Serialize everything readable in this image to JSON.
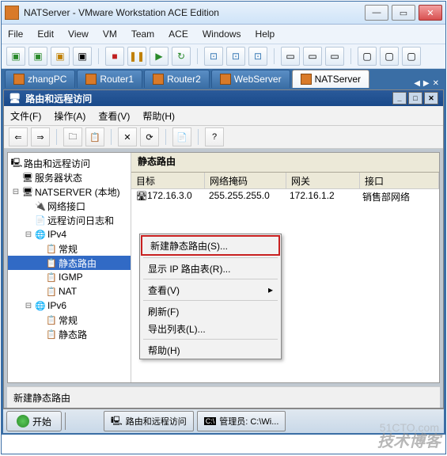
{
  "window": {
    "title": "NATServer - VMware Workstation ACE Edition"
  },
  "menubar": [
    "File",
    "Edit",
    "View",
    "VM",
    "Team",
    "ACE",
    "Windows",
    "Help"
  ],
  "tabs": [
    {
      "label": "zhangPC"
    },
    {
      "label": "Router1"
    },
    {
      "label": "Router2"
    },
    {
      "label": "WebServer"
    },
    {
      "label": "NATServer",
      "active": true
    }
  ],
  "inner": {
    "title": "路由和远程访问",
    "menu": [
      "文件(F)",
      "操作(A)",
      "查看(V)",
      "帮助(H)"
    ]
  },
  "tree": {
    "root": "路由和远程访问",
    "status": "服务器状态",
    "server": "NATSERVER (本地)",
    "items": {
      "netif": "网络接口",
      "remotelog": "远程访问日志和",
      "ipv4": "IPv4",
      "ipv4_general": "常规",
      "ipv4_static": "静态路由",
      "ipv4_igmp": "IGMP",
      "ipv4_nat": "NAT",
      "ipv6": "IPv6",
      "ipv6_general": "常规",
      "ipv6_static": "静态路"
    }
  },
  "panel": {
    "title": "静态路由",
    "headers": [
      "目标",
      "网络掩码",
      "网关",
      "接口"
    ],
    "row": [
      "172.16.3.0",
      "255.255.255.0",
      "172.16.1.2",
      "销售部网络"
    ]
  },
  "ctxmenu": {
    "new": "新建静态路由(S)...",
    "show": "显示 IP 路由表(R)...",
    "view": "查看(V)",
    "refresh": "刷新(F)",
    "export": "导出列表(L)...",
    "help": "帮助(H)"
  },
  "statusbar": "新建静态路由",
  "taskbar": {
    "start": "开始",
    "app": "路由和远程访问",
    "cmd": "管理员: C:\\Wi..."
  },
  "watermark": {
    "top": "51CTO.com",
    "bottom": "技术博客"
  }
}
